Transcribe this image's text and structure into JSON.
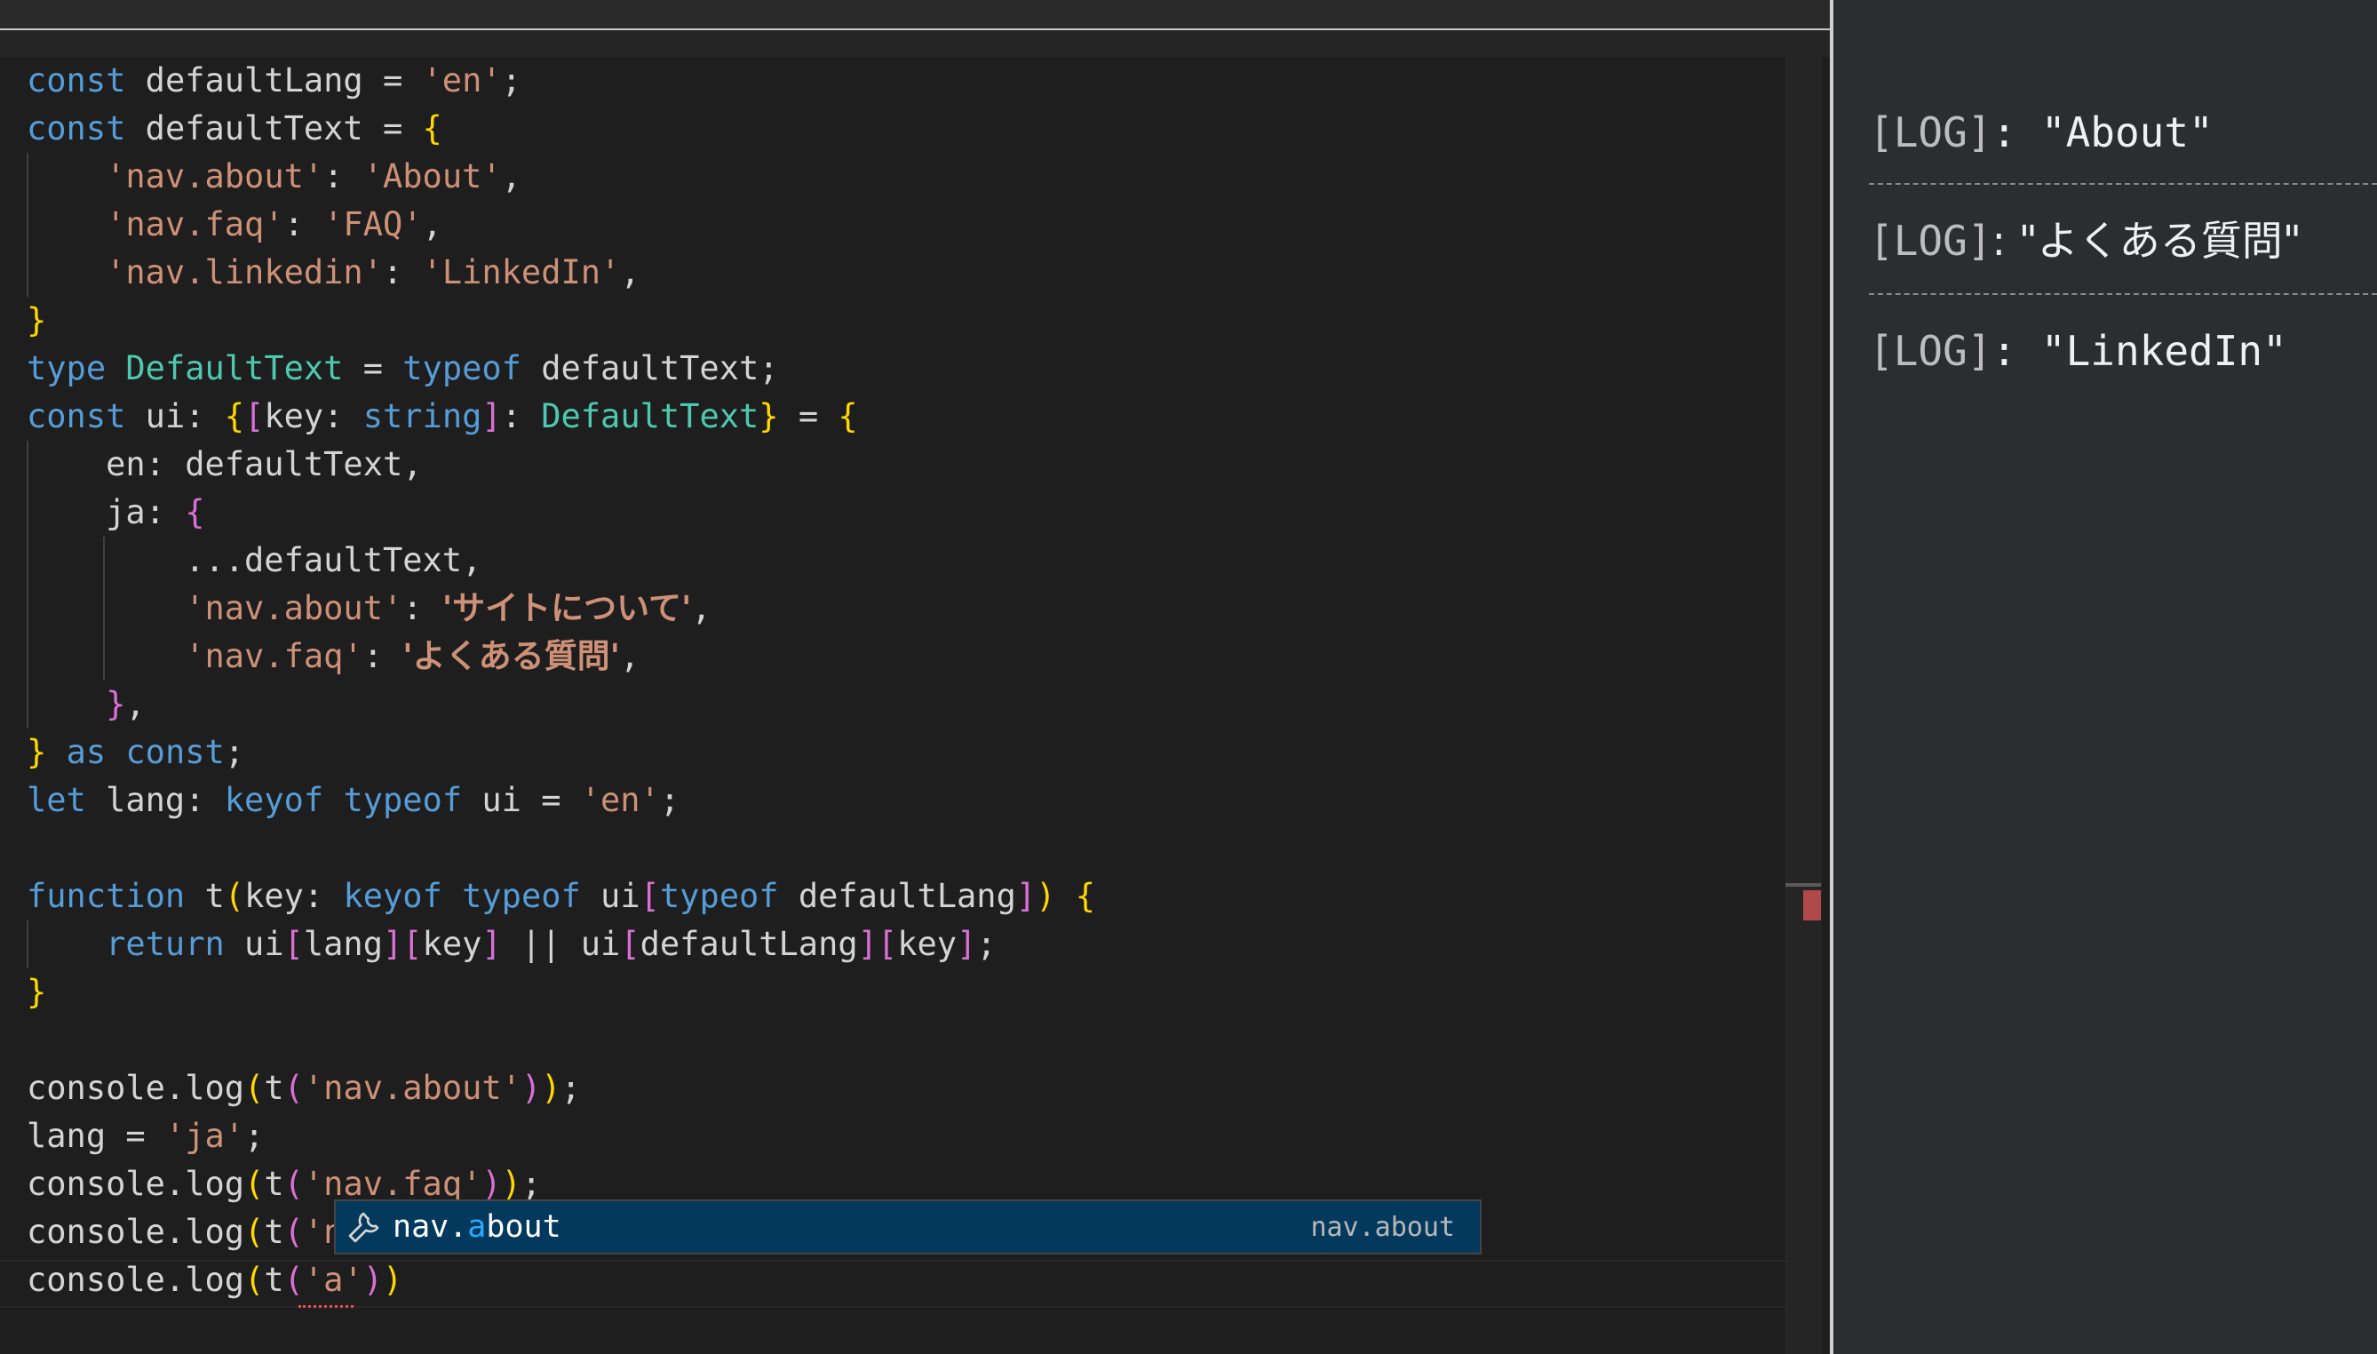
{
  "editor": {
    "lines": [
      [
        [
          "kw",
          "const"
        ],
        [
          "id",
          " defaultLang = "
        ],
        [
          "str",
          "'en'"
        ],
        [
          "id",
          ";"
        ]
      ],
      [
        [
          "kw",
          "const"
        ],
        [
          "id",
          " defaultText = "
        ],
        [
          "br1",
          "{"
        ]
      ],
      [
        [
          "id",
          "    "
        ],
        [
          "str",
          "'nav.about'"
        ],
        [
          "id",
          ": "
        ],
        [
          "str",
          "'About'"
        ],
        [
          "id",
          ","
        ]
      ],
      [
        [
          "id",
          "    "
        ],
        [
          "str",
          "'nav.faq'"
        ],
        [
          "id",
          ": "
        ],
        [
          "str",
          "'FAQ'"
        ],
        [
          "id",
          ","
        ]
      ],
      [
        [
          "id",
          "    "
        ],
        [
          "str",
          "'nav.linkedin'"
        ],
        [
          "id",
          ": "
        ],
        [
          "str",
          "'LinkedIn'"
        ],
        [
          "id",
          ","
        ]
      ],
      [
        [
          "br1",
          "}"
        ]
      ],
      [
        [
          "kw",
          "type"
        ],
        [
          "id",
          " "
        ],
        [
          "ty",
          "DefaultText"
        ],
        [
          "id",
          " = "
        ],
        [
          "kw",
          "typeof"
        ],
        [
          "id",
          " defaultText;"
        ]
      ],
      [
        [
          "kw",
          "const"
        ],
        [
          "id",
          " ui: "
        ],
        [
          "br1",
          "{"
        ],
        [
          "br2",
          "["
        ],
        [
          "id",
          "key: "
        ],
        [
          "kw",
          "string"
        ],
        [
          "br2",
          "]"
        ],
        [
          "id",
          ": "
        ],
        [
          "ty",
          "DefaultText"
        ],
        [
          "br1",
          "}"
        ],
        [
          "id",
          " = "
        ],
        [
          "br1",
          "{"
        ]
      ],
      [
        [
          "id",
          "    en: defaultText,"
        ]
      ],
      [
        [
          "id",
          "    ja: "
        ],
        [
          "br2",
          "{"
        ]
      ],
      [
        [
          "id",
          "        ...defaultText,"
        ]
      ],
      [
        [
          "id",
          "        "
        ],
        [
          "str",
          "'nav.about'"
        ],
        [
          "id",
          ": "
        ],
        [
          "strjp",
          "'サイトについて'"
        ],
        [
          "id",
          ","
        ]
      ],
      [
        [
          "id",
          "        "
        ],
        [
          "str",
          "'nav.faq'"
        ],
        [
          "id",
          ": "
        ],
        [
          "strjp",
          "'よくある質問'"
        ],
        [
          "id",
          ","
        ]
      ],
      [
        [
          "id",
          "    "
        ],
        [
          "br2",
          "}"
        ],
        [
          "id",
          ","
        ]
      ],
      [
        [
          "br1",
          "}"
        ],
        [
          "id",
          " "
        ],
        [
          "kw",
          "as"
        ],
        [
          "id",
          " "
        ],
        [
          "kw",
          "const"
        ],
        [
          "id",
          ";"
        ]
      ],
      [
        [
          "kw",
          "let"
        ],
        [
          "id",
          " lang: "
        ],
        [
          "kw",
          "keyof"
        ],
        [
          "id",
          " "
        ],
        [
          "kw",
          "typeof"
        ],
        [
          "id",
          " ui = "
        ],
        [
          "str",
          "'en'"
        ],
        [
          "id",
          ";"
        ]
      ],
      [
        [
          "id",
          ""
        ]
      ],
      [
        [
          "kw",
          "function"
        ],
        [
          "id",
          " t"
        ],
        [
          "br1",
          "("
        ],
        [
          "id",
          "key: "
        ],
        [
          "kw",
          "keyof"
        ],
        [
          "id",
          " "
        ],
        [
          "kw",
          "typeof"
        ],
        [
          "id",
          " ui"
        ],
        [
          "br2",
          "["
        ],
        [
          "kw",
          "typeof"
        ],
        [
          "id",
          " defaultLang"
        ],
        [
          "br2",
          "]"
        ],
        [
          "br1",
          ")"
        ],
        [
          "id",
          " "
        ],
        [
          "br1",
          "{"
        ]
      ],
      [
        [
          "id",
          "    "
        ],
        [
          "kw",
          "return"
        ],
        [
          "id",
          " ui"
        ],
        [
          "br2",
          "["
        ],
        [
          "id",
          "lang"
        ],
        [
          "br2",
          "]"
        ],
        [
          "br2",
          "["
        ],
        [
          "id",
          "key"
        ],
        [
          "br2",
          "]"
        ],
        [
          "id",
          " || ui"
        ],
        [
          "br2",
          "["
        ],
        [
          "id",
          "defaultLang"
        ],
        [
          "br2",
          "]"
        ],
        [
          "br2",
          "["
        ],
        [
          "id",
          "key"
        ],
        [
          "br2",
          "]"
        ],
        [
          "id",
          ";"
        ]
      ],
      [
        [
          "br1",
          "}"
        ]
      ],
      [
        [
          "id",
          ""
        ]
      ],
      [
        [
          "id",
          "console.log"
        ],
        [
          "br1",
          "("
        ],
        [
          "id",
          "t"
        ],
        [
          "br2",
          "("
        ],
        [
          "str",
          "'nav.about'"
        ],
        [
          "br2",
          ")"
        ],
        [
          "br1",
          ")"
        ],
        [
          "id",
          ";"
        ]
      ],
      [
        [
          "id",
          "lang = "
        ],
        [
          "str",
          "'ja'"
        ],
        [
          "id",
          ";"
        ]
      ],
      [
        [
          "id",
          "console.log"
        ],
        [
          "br1",
          "("
        ],
        [
          "id",
          "t"
        ],
        [
          "br2",
          "("
        ],
        [
          "str",
          "'nav.faq'"
        ],
        [
          "br2",
          ")"
        ],
        [
          "br1",
          ")"
        ],
        [
          "id",
          ";"
        ]
      ],
      [
        [
          "id",
          "console.log"
        ],
        [
          "br1",
          "("
        ],
        [
          "id",
          "t"
        ],
        [
          "br2",
          "("
        ],
        [
          "str",
          "'n"
        ]
      ],
      [
        [
          "id",
          "console.log"
        ],
        [
          "br1",
          "("
        ],
        [
          "id",
          "t"
        ],
        [
          "br2",
          "("
        ],
        [
          "str",
          "'a'"
        ],
        [
          "br2",
          ")"
        ],
        [
          "br1",
          ")"
        ]
      ]
    ]
  },
  "suggest": {
    "label_prefix": "nav.",
    "label_match": "a",
    "label_rest": "bout",
    "detail": "nav.about",
    "icon": "wrench-icon"
  },
  "console": {
    "entries": [
      {
        "tag": "[LOG]",
        "text": ": \"About\""
      },
      {
        "tag": "[LOG]",
        "text": ": \"よくある質問\""
      },
      {
        "tag": "[LOG]",
        "text": ": \"LinkedIn\""
      }
    ]
  },
  "colors": {
    "keyword": "#569cd6",
    "type": "#4ec9b0",
    "string": "#ce9178",
    "bracket1": "#ffd700",
    "bracket2": "#da70d6",
    "suggest_bg": "#04395e",
    "match": "#2aaaff"
  }
}
